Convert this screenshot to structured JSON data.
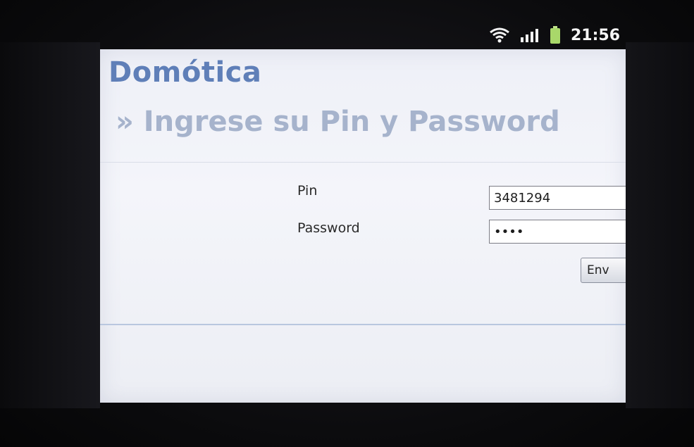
{
  "status_bar": {
    "time": "21:56",
    "icons": [
      "wifi-icon",
      "signal-icon",
      "battery-icon"
    ]
  },
  "page": {
    "title": "Domótica",
    "subtitle": "» Ingrese su Pin y Password"
  },
  "form": {
    "pin_label": "Pin",
    "pin_value": "3481294",
    "password_label": "Password",
    "password_value": "••••",
    "submit_label": "Env"
  },
  "colors": {
    "title": "#5f7fb8",
    "subtitle": "#a6b3cc",
    "background": "#eef0f7"
  }
}
